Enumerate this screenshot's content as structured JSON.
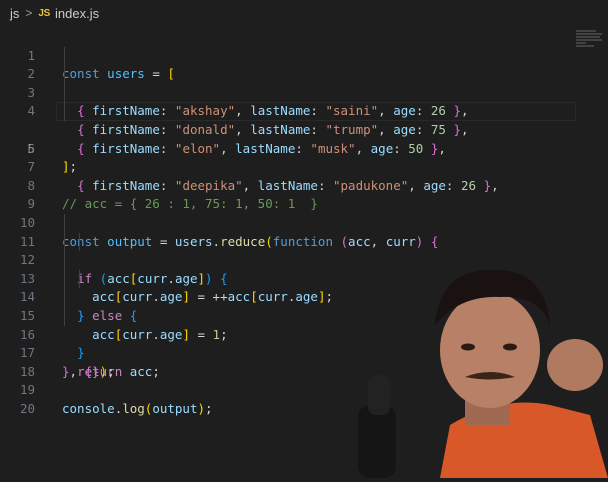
{
  "breadcrumb": {
    "folder": "js",
    "file_icon": "JS",
    "file": "index.js"
  },
  "code": {
    "line_numbers": [
      "1",
      "2",
      "3",
      "4",
      "5",
      "6",
      "7",
      "8",
      "9",
      "10",
      "11",
      "12",
      "13",
      "14",
      "15",
      "16",
      "17",
      "18",
      "19",
      "20"
    ],
    "active_line": "5",
    "users": [
      {
        "firstName": "\"akshay\"",
        "lastName": "\"saini\"",
        "age": "26"
      },
      {
        "firstName": "\"donald\"",
        "lastName": "\"trump\"",
        "age": "75"
      },
      {
        "firstName": "\"elon\"",
        "lastName": "\"musk\"",
        "age": "50"
      },
      {
        "firstName": "\"deepika\"",
        "lastName": "\"padukone\"",
        "age": "26"
      }
    ],
    "comment": "// acc = { 26 : 1, 75: 1, 50: 1  }"
  },
  "colors": {
    "background": "#1e1e1e",
    "keyword": "#569cd6",
    "string": "#ce9178",
    "number": "#b5cea8",
    "comment": "#6a9955"
  },
  "presenter": {
    "icon": "webcam-presenter-icon"
  }
}
